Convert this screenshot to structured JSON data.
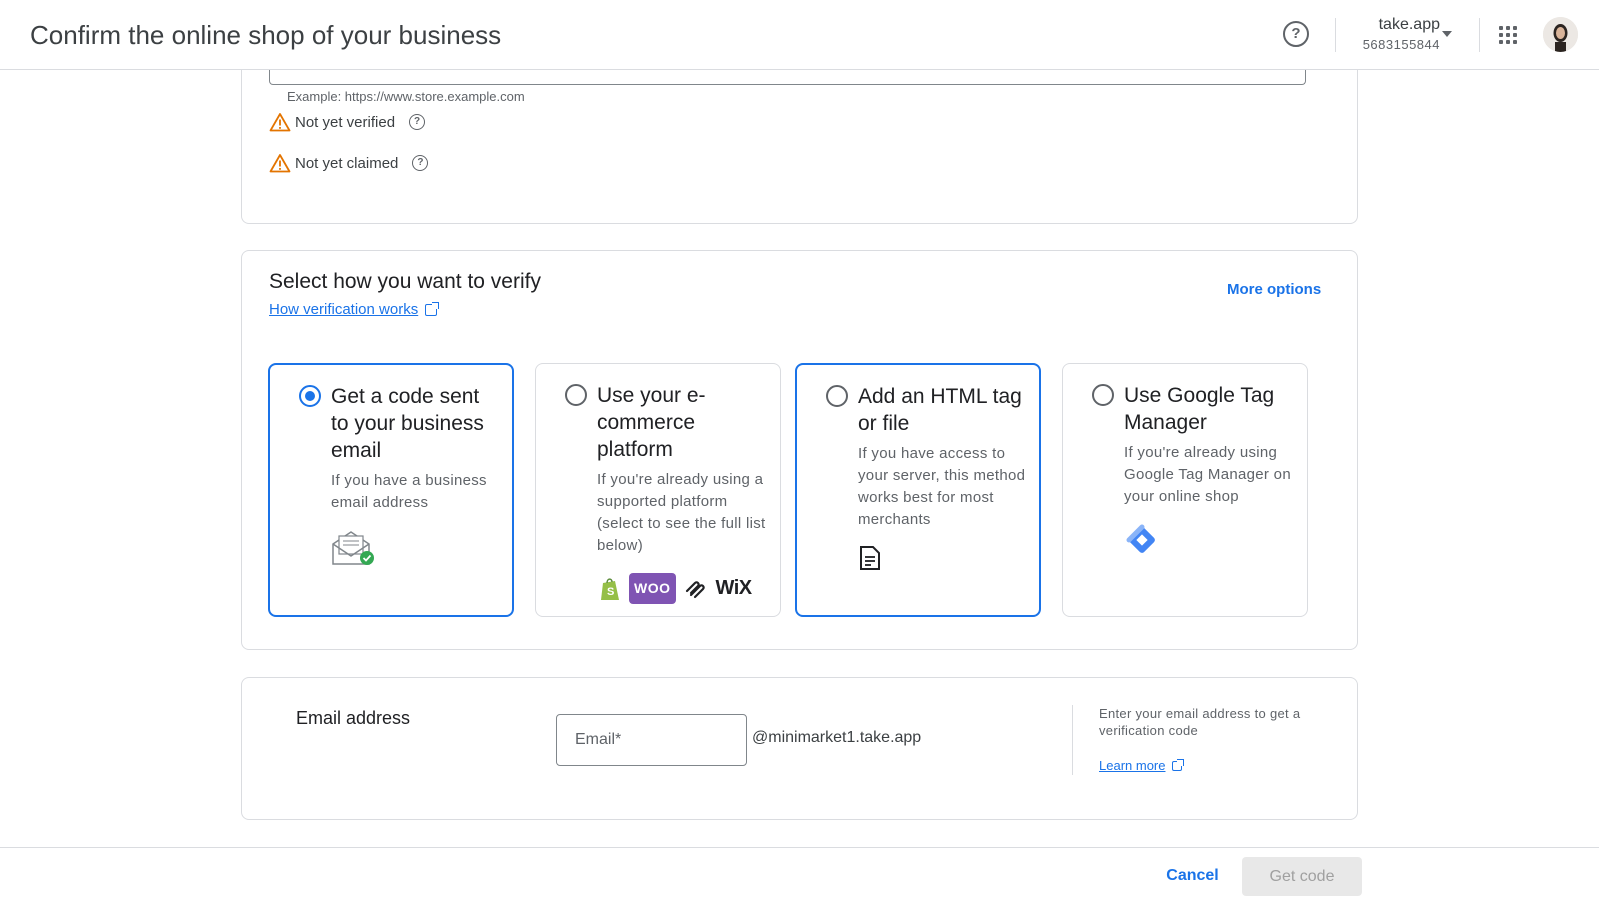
{
  "header": {
    "title": "Confirm the online shop of your business",
    "account_name": "take.app",
    "account_number": "5683155844"
  },
  "website": {
    "helper_text": "Example: https://www.store.example.com",
    "status_verified": "Not yet verified",
    "status_claimed": "Not yet claimed"
  },
  "verify": {
    "title": "Select how you want to verify",
    "how_link": "How verification works",
    "more_options": "More options",
    "options": [
      {
        "title": "Get a code sent to your business email",
        "desc": "If you have a business email address",
        "icon": "envelope-check-icon",
        "selected": true
      },
      {
        "title": "Use your e-commerce platform",
        "desc": "If you're already using a supported platform (select to see the full list below)",
        "icon": "platform-logos",
        "selected": false
      },
      {
        "title": "Add an HTML tag or file",
        "desc": "If you have access to your server, this method works best for most merchants",
        "icon": "document-icon",
        "selected": false
      },
      {
        "title": "Use Google Tag Manager",
        "desc": "If you're already using Google Tag Manager on your online shop",
        "icon": "tag-manager-icon",
        "selected": false
      }
    ],
    "platform_logo_wix": "WiX",
    "platform_logo_woo": "WOO"
  },
  "email": {
    "label": "Email address",
    "placeholder": "Email*",
    "domain": "@minimarket1.take.app",
    "side_text": "Enter your email address to get a verification code",
    "learn_more": "Learn more"
  },
  "footer": {
    "cancel": "Cancel",
    "get_code": "Get code"
  },
  "colors": {
    "accent": "#1a73e8",
    "warning": "#e37400",
    "shopify": "#95bf47",
    "woo": "#7f54b3",
    "gtm": "#4285f4"
  }
}
